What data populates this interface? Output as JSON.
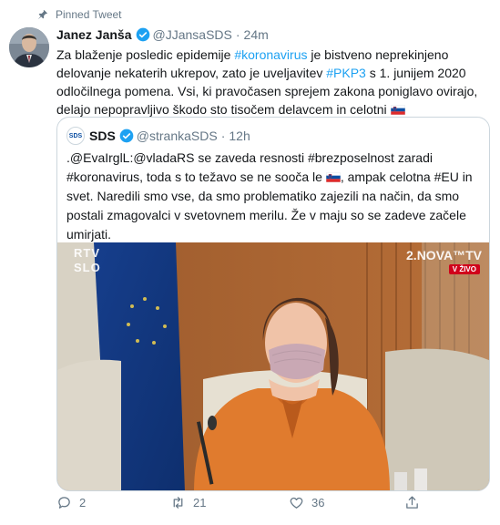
{
  "pinned": {
    "label": "Pinned Tweet"
  },
  "tweet": {
    "author_name": "Janez Janša",
    "handle": "@JJansaSDS",
    "separator": "·",
    "time": "24m",
    "text_parts": {
      "p1": "Za blaženje posledic epidemije ",
      "tag1": "#koronavirus",
      "p2": " je bistveno neprekinjeno delovanje nekaterih ukrepov, zato je uveljavitev ",
      "tag2": "#PKP3",
      "p3": " s 1. junijem 2020 odločilnega pomena. Vsi, ki pravočasen sprejem zakona poniglavo ovirajo, delajo nepopravljivo škodo sto tisočem delavcem in celotni "
    }
  },
  "quote": {
    "avatar_text": "SDS",
    "author_name": "SDS",
    "handle": "@strankaSDS",
    "separator": "·",
    "time": "12h",
    "text_parts": {
      "p1": ".@EvaIrglL:@vladaRS se zaveda resnosti #brezposelnost zaradi #koronavirus, toda s to težavo se ne sooča le ",
      "p2": ", ampak celotna #EU in svet. Naredili smo vse, da smo problematiko zajezili na način, da smo postali zmagovalci v svetovnem merilu. Že v maju so se zadeve začele umirjati."
    },
    "media": {
      "watermark_left_1": "RTV",
      "watermark_left_2": "SLO",
      "watermark_right": "2.NOVA™TV",
      "live_badge": "V ŽIVO"
    }
  },
  "actions": {
    "replies": "2",
    "retweets": "21",
    "likes": "36"
  },
  "colors": {
    "link": "#1da1f2",
    "secondary_text": "#657786",
    "border": "#ccd6dd"
  }
}
